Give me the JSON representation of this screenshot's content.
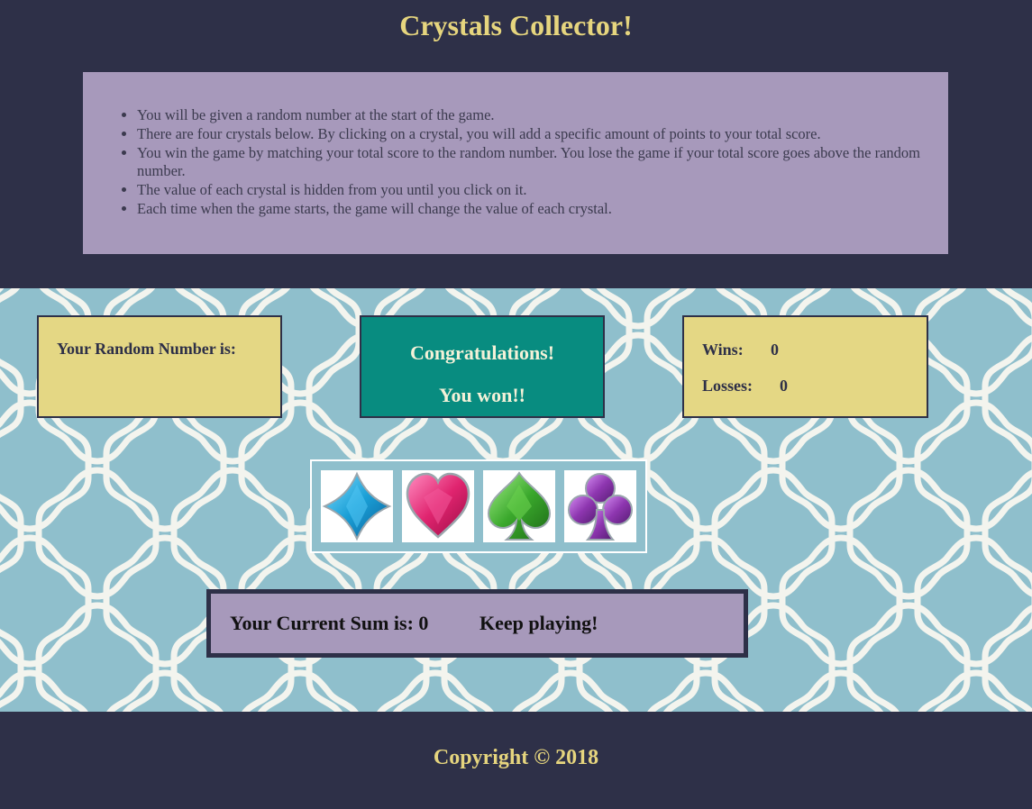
{
  "header": {
    "title": "Crystals Collector!",
    "rules": [
      "You will be given a random number at the start of the game.",
      "There are four crystals below. By clicking on a crystal, you will add a specific amount of points to your total score.",
      "You win the game by matching your total score to the random number. You lose the game if your total score goes above the random number.",
      "The value of each crystal is hidden from you until you click on it.",
      "Each time when the game starts, the game will change the value of each crystal."
    ]
  },
  "game": {
    "random_label": "Your Random Number is:",
    "random_value": "",
    "message_line1": "Congratulations!",
    "message_line2": "You won!!",
    "wins_label": "Wins:",
    "wins_value": "0",
    "losses_label": "Losses:",
    "losses_value": "0",
    "crystals": [
      {
        "icon": "blue-diamond-crystal-icon",
        "color": "#1a9fd6"
      },
      {
        "icon": "pink-heart-crystal-icon",
        "color": "#e0246f"
      },
      {
        "icon": "green-spade-crystal-icon",
        "color": "#3aa82c"
      },
      {
        "icon": "purple-club-crystal-icon",
        "color": "#8e36b0"
      }
    ],
    "sum_label": "Your Current Sum is: 0",
    "status": "Keep playing!"
  },
  "footer": {
    "copyright": "Copyright © 2018"
  },
  "colors": {
    "navy": "#2e3048",
    "gold": "#e6d57e",
    "lavender": "#a799bb",
    "teal": "#088c80",
    "sky": "#8fbfcc"
  }
}
